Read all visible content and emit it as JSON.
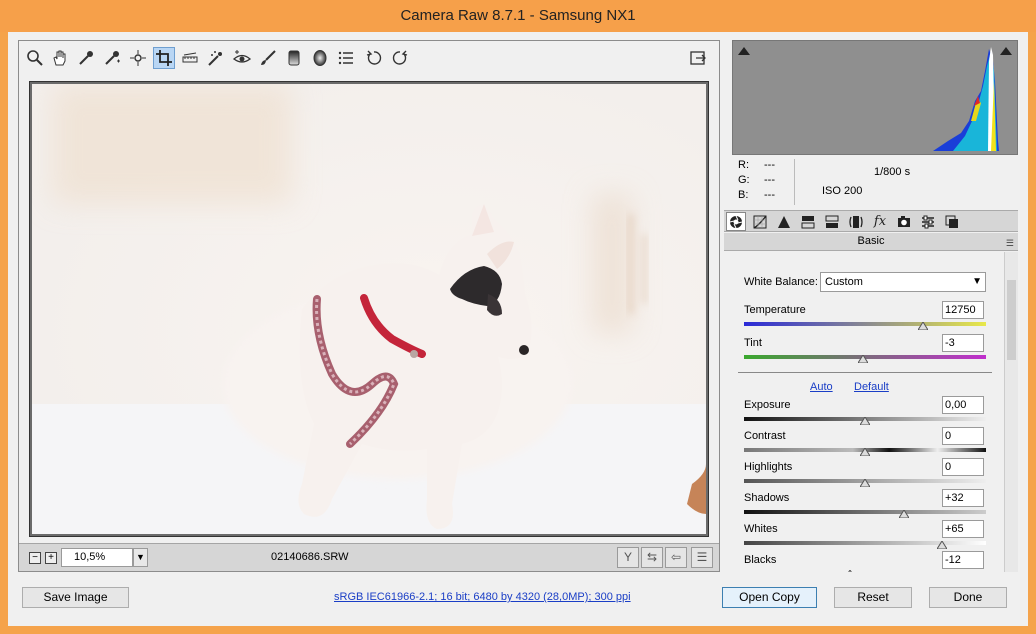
{
  "window": {
    "title": "Camera Raw 8.7.1  -  Samsung NX1"
  },
  "toolbar": {
    "tools": [
      "zoom-tool",
      "hand-tool",
      "white-balance-tool",
      "color-sampler-tool",
      "targeted-adjustment-tool",
      "crop-tool",
      "straighten-tool",
      "spot-removal-tool",
      "red-eye-tool",
      "adjustment-brush-tool",
      "graduated-filter-tool",
      "radial-filter-tool",
      "preferences-tool",
      "rotate-ccw-tool",
      "rotate-cw-tool",
      "fullscreen-toggle"
    ],
    "active": "crop-tool"
  },
  "status": {
    "zoom_minus": "−",
    "zoom_plus": "+",
    "zoom": "10,5%",
    "filename": "02140686.SRW"
  },
  "info": {
    "r_label": "R:",
    "r_value": "---",
    "g_label": "G:",
    "g_value": "---",
    "b_label": "B:",
    "b_value": "---",
    "shutter": "1/800 s",
    "iso": "ISO 200"
  },
  "panel": {
    "title": "Basic",
    "white_balance_label": "White Balance:",
    "white_balance_value": "Custom",
    "auto": "Auto",
    "default": "Default",
    "sliders": {
      "temperature": {
        "label": "Temperature",
        "value": "12750",
        "position": 0.74
      },
      "tint": {
        "label": "Tint",
        "value": "-3",
        "position": 0.49
      },
      "exposure": {
        "label": "Exposure",
        "value": "0,00",
        "position": 0.5
      },
      "contrast": {
        "label": "Contrast",
        "value": "0",
        "position": 0.5
      },
      "highlights": {
        "label": "Highlights",
        "value": "0",
        "position": 0.5
      },
      "shadows": {
        "label": "Shadows",
        "value": "+32",
        "position": 0.66
      },
      "whites": {
        "label": "Whites",
        "value": "+65",
        "position": 0.82
      },
      "blacks": {
        "label": "Blacks",
        "value": "-12",
        "position": 0.44
      }
    }
  },
  "footer": {
    "save_image": "Save Image",
    "workflow": "sRGB IEC61966-2.1; 16 bit; 6480 by 4320 (28,0MP); 300 ppi",
    "open_copy": "Open Copy",
    "reset": "Reset",
    "done": "Done"
  },
  "colors": {
    "titlebar": "#f6a04a",
    "link": "#1a3ec6",
    "harness": "#c4253a"
  }
}
